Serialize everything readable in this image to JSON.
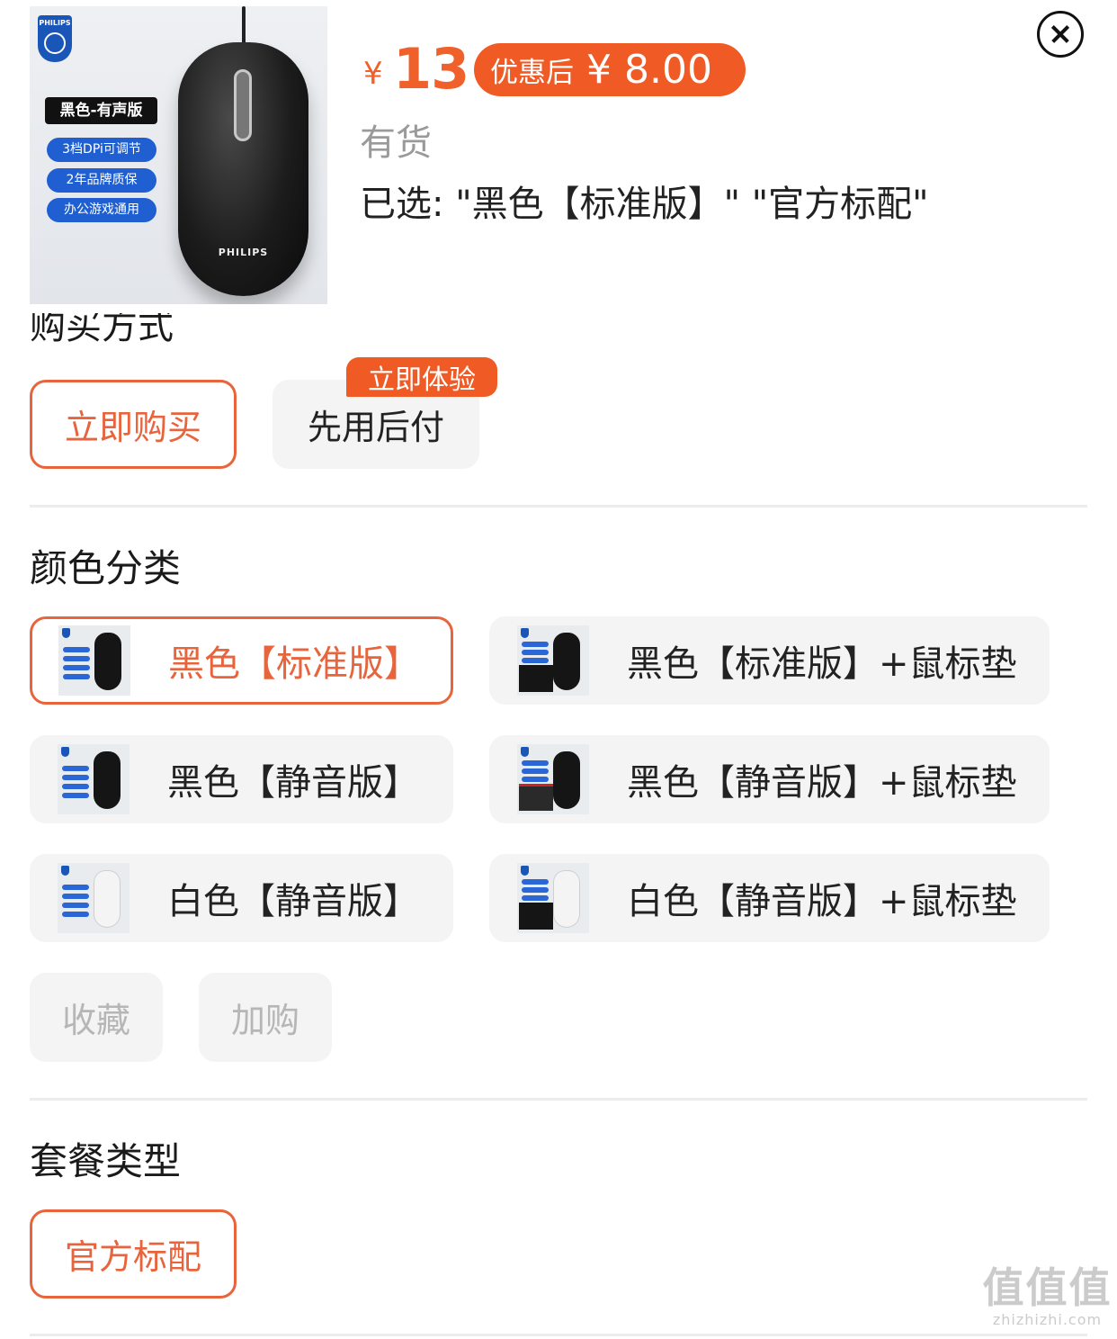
{
  "product": {
    "thumb_logo": "PHILIPS",
    "thumb_tag_main": "黑色-有声版",
    "thumb_tags": [
      "3档DPi可调节",
      "2年品牌质保",
      "办公游戏通用"
    ],
    "thumb_mouse_brand": "PHILIPS"
  },
  "price": {
    "currency": "¥",
    "amount": "13",
    "discount_label": "优惠后",
    "discount_amount": "¥ 8.00"
  },
  "stock_status": "有货",
  "selected_text": "已选: \"黑色【标准版】\" \"官方标配\"",
  "purchase": {
    "heading": "购买方式",
    "options": [
      {
        "label": "立即购买",
        "selected": true
      },
      {
        "label": "先用后付",
        "selected": false
      }
    ],
    "badge": "立即体验"
  },
  "color": {
    "heading": "颜色分类",
    "options": [
      {
        "label": "黑色【标准版】",
        "selected": true
      },
      {
        "label": "黑色【标准版】+鼠标垫",
        "selected": false
      },
      {
        "label": "黑色【静音版】",
        "selected": false
      },
      {
        "label": "黑色【静音版】+鼠标垫",
        "selected": false
      },
      {
        "label": "白色【静音版】",
        "selected": false
      },
      {
        "label": "白色【静音版】+鼠标垫",
        "selected": false
      }
    ],
    "extra_buttons": [
      "收藏",
      "加购"
    ]
  },
  "package": {
    "heading": "套餐类型",
    "options": [
      {
        "label": "官方标配",
        "selected": true
      }
    ]
  },
  "watermark": {
    "big": "值值值",
    "small": "zhizhizhi.com"
  },
  "colors": {
    "accent": "#f05a24",
    "selected_border": "#e8643d",
    "muted_text": "#9a9a9a",
    "option_bg": "#f4f4f4"
  },
  "icons": [
    "close-icon"
  ]
}
